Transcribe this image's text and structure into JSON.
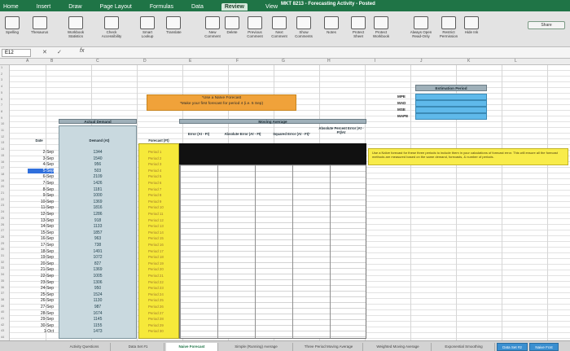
{
  "window": {
    "title": "MKT 8213 - Forecasting Activity - Posted"
  },
  "menu": [
    "Home",
    "Insert",
    "Draw",
    "Page Layout",
    "Formulas",
    "Data",
    "Review",
    "View"
  ],
  "ribbon": {
    "spelling": "Spelling",
    "thesaurus": "Thesaurus",
    "workbook_stats": "Workbook Statistics",
    "check_accessibility": "Check Accessibility",
    "smart_lookup": "Smart Lookup",
    "translate": "Translate",
    "new_comment": "New Comment",
    "delete": "Delete",
    "previous_comment": "Previous Comment",
    "next_comment": "Next Comment",
    "show_comments": "Show Comments",
    "notes": "Notes",
    "protect_sheet": "Protect Sheet",
    "protect_workbook": "Protect Workbook",
    "always_open_readonly": "Always Open Read-Only",
    "restrict_permission": "Restrict Permission",
    "hide_ink": "Hide Ink",
    "share": "Share"
  },
  "formula_bar": {
    "cell_ref": "E12",
    "fx": "fx",
    "value": ""
  },
  "columns": [
    "A",
    "B",
    "C",
    "D",
    "E",
    "F",
    "G",
    "H",
    "I",
    "J",
    "K",
    "L"
  ],
  "note": {
    "line1": "*Use a Naïve Forecast",
    "line2": "*Make your first forecast for period 4 (i.e. 5 Sep)"
  },
  "headers": {
    "actual_demand": "Actual Demand",
    "moving_average": "Moving Average",
    "date": "Date",
    "demand": "Demand (At)",
    "forecast": "Forecast (Ft)",
    "error": "Error (At - Ft)",
    "absolute_error": "Absolute Error |At - Ft|",
    "squared_error": "Squared Error (At - Ft)²",
    "abs_percent_error": "Absolute Percent Error |At - Ft|/At"
  },
  "rows": [
    {
      "date": "2-Sep",
      "demand": "1344",
      "period": "Period 1"
    },
    {
      "date": "3-Sep",
      "demand": "1540",
      "period": "Period 2"
    },
    {
      "date": "4-Sep",
      "demand": "956",
      "period": "Period 3"
    },
    {
      "date": "5-Sep",
      "demand": "503",
      "period": "Period 4"
    },
    {
      "date": "6-Sep",
      "demand": "2109",
      "period": "Period 5"
    },
    {
      "date": "7-Sep",
      "demand": "1426",
      "period": "Period 6"
    },
    {
      "date": "8-Sep",
      "demand": "1181",
      "period": "Period 7"
    },
    {
      "date": "9-Sep",
      "demand": "1000",
      "period": "Period 8"
    },
    {
      "date": "10-Sep",
      "demand": "1369",
      "period": "Period 9"
    },
    {
      "date": "11-Sep",
      "demand": "1816",
      "period": "Period 10"
    },
    {
      "date": "12-Sep",
      "demand": "1286",
      "period": "Period 11"
    },
    {
      "date": "13-Sep",
      "demand": "918",
      "period": "Period 12"
    },
    {
      "date": "14-Sep",
      "demand": "1133",
      "period": "Period 13"
    },
    {
      "date": "15-Sep",
      "demand": "1857",
      "period": "Period 14"
    },
    {
      "date": "16-Sep",
      "demand": "963",
      "period": "Period 15"
    },
    {
      "date": "17-Sep",
      "demand": "738",
      "period": "Period 16"
    },
    {
      "date": "18-Sep",
      "demand": "1491",
      "period": "Period 17"
    },
    {
      "date": "19-Sep",
      "demand": "1072",
      "period": "Period 18"
    },
    {
      "date": "20-Sep",
      "demand": "827",
      "period": "Period 19"
    },
    {
      "date": "21-Sep",
      "demand": "1369",
      "period": "Period 20"
    },
    {
      "date": "22-Sep",
      "demand": "1005",
      "period": "Period 21"
    },
    {
      "date": "23-Sep",
      "demand": "1306",
      "period": "Period 22"
    },
    {
      "date": "24-Sep",
      "demand": "950",
      "period": "Period 23"
    },
    {
      "date": "25-Sep",
      "demand": "1524",
      "period": "Period 24"
    },
    {
      "date": "26-Sep",
      "demand": "1130",
      "period": "Period 25"
    },
    {
      "date": "27-Sep",
      "demand": "987",
      "period": "Period 26"
    },
    {
      "date": "28-Sep",
      "demand": "1674",
      "period": "Period 27"
    },
    {
      "date": "29-Sep",
      "demand": "1145",
      "period": "Period 28"
    },
    {
      "date": "30-Sep",
      "demand": "1155",
      "period": "Period 29"
    },
    {
      "date": "1-Oct",
      "demand": "1473",
      "period": "Period 30"
    }
  ],
  "estimation": {
    "title": "Estimation Period",
    "metrics": [
      "MPE",
      "MAD",
      "MSE",
      "MAPE"
    ]
  },
  "yellow_note": "Use a Naïve forecast for these three periods to include them in your calculations of forecast error. This will ensure all the forecast methods are measured based on the same demand, forecasts, & number of periods.",
  "tabs": [
    "Activity Questions",
    "Data Set #1",
    "Naive Forecast",
    "Simple (Running) Average",
    "Three Period Moving Average",
    "Weighted Moving Average",
    "Exponential Smoothing",
    "Data Set #2",
    "Naive Fcst"
  ]
}
